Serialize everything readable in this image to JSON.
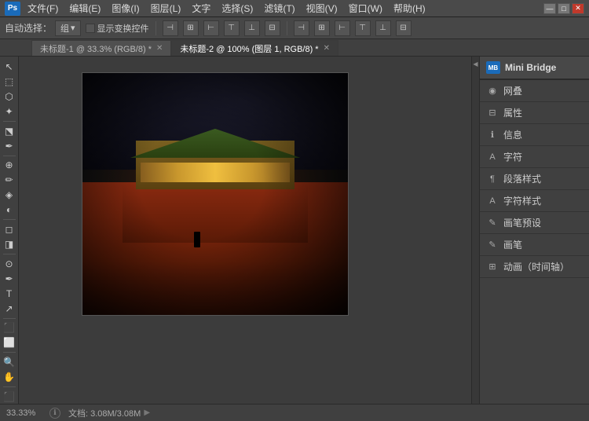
{
  "titlebar": {
    "logo": "Ps",
    "menus": [
      "文件(F)",
      "编辑(E)",
      "图像(I)",
      "图层(L)",
      "文字",
      "选择(S)",
      "滤镜(T)",
      "视图(V)",
      "窗口(W)",
      "帮助(H)"
    ],
    "controls": [
      "—",
      "□",
      "✕"
    ]
  },
  "optionsbar": {
    "tool_label": "自动选择：",
    "tool_dropdown": "组",
    "checkbox_label": "显示变换控件",
    "align_icons": [
      "⊣",
      "⊢",
      "⊤",
      "⊥",
      "⊞",
      "⊟"
    ]
  },
  "tabs": [
    {
      "label": "未标题-1 @ 33.3% (RGB/8) *",
      "active": false,
      "closable": true
    },
    {
      "label": "未标题-2 @ 100% (图层 1, RGB/8) *",
      "active": true,
      "closable": true
    }
  ],
  "toolbar": {
    "tools": [
      "↖",
      "⬚",
      "⬡",
      "✂",
      "✒",
      "⬔",
      "⛶",
      "T",
      "✏",
      "◈",
      "◐",
      "⊕",
      "🔍",
      "✋",
      "⬛"
    ]
  },
  "rightpanel": {
    "mini_bridge": {
      "icon": "MB",
      "title": "Mini Bridge"
    },
    "items": [
      {
        "id": "network",
        "icon": "◉",
        "label": "网叠"
      },
      {
        "id": "properties",
        "icon": "⊟",
        "label": "属性"
      },
      {
        "id": "info",
        "icon": "ℹ",
        "label": "信息"
      },
      {
        "id": "character",
        "icon": "A",
        "label": "字符"
      },
      {
        "id": "paragraph-style",
        "icon": "¶",
        "label": "段落样式"
      },
      {
        "id": "char-style",
        "icon": "A",
        "label": "字符样式"
      },
      {
        "id": "brush-preset",
        "icon": "✎",
        "label": "画笔预设"
      },
      {
        "id": "brush",
        "icon": "✎",
        "label": "画笔"
      },
      {
        "id": "animation",
        "icon": "⊞",
        "label": "动画（时间轴）"
      }
    ]
  },
  "statusbar": {
    "zoom": "33.33%",
    "doc_label": "文档: 3.08M/3.08M"
  }
}
